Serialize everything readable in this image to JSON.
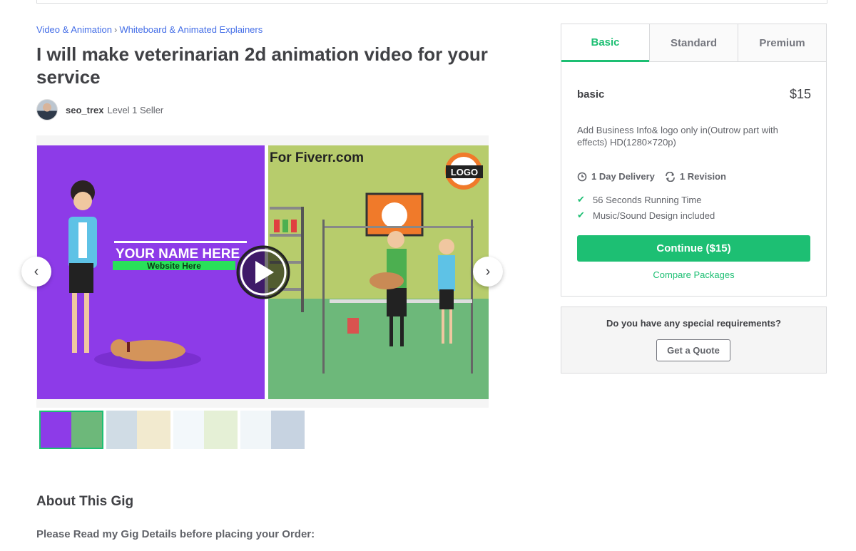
{
  "breadcrumb": {
    "category": "Video & Animation",
    "separator": "›",
    "subcategory": "Whiteboard & Animated Explainers"
  },
  "gig": {
    "title": "I will make veterinarian 2d animation video for your service"
  },
  "seller": {
    "username": "seo_trex",
    "level": "Level 1 Seller"
  },
  "gallery": {
    "brand_text": "For Fiverr.com",
    "logo_text": "LOGO",
    "name_placeholder": "YOUR NAME HERE",
    "website_placeholder": "Website Here",
    "prev_icon": "chevron-left-icon",
    "next_icon": "chevron-right-icon",
    "play_icon": "play-icon",
    "thumbnail_count": 4
  },
  "package_tabs": [
    "Basic",
    "Standard",
    "Premium"
  ],
  "package": {
    "name": "basic",
    "price": "$15",
    "description": "Add Business Info& logo only in(Outrow part with effects) HD(1280×720p)",
    "delivery": "1 Day Delivery",
    "revisions": "1 Revision",
    "features": [
      "56 Seconds Running Time",
      "Music/Sound Design included"
    ],
    "cta": "Continue ($15)",
    "compare": "Compare Packages"
  },
  "requirements": {
    "question": "Do you have any special requirements?",
    "button": "Get a Quote"
  },
  "about": {
    "heading": "About This Gig",
    "intro": "Please Read my Gig Details before placing your Order:"
  },
  "colors": {
    "accent": "#1dbf73",
    "link": "#446ee7",
    "purple": "#8d3be8",
    "scene_green": "#6db87a"
  }
}
